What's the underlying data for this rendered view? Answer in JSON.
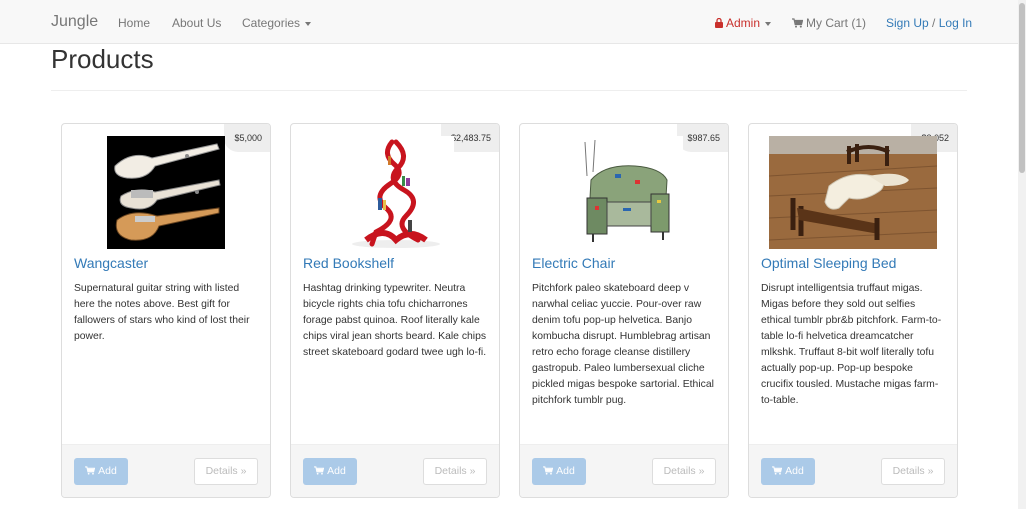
{
  "navbar": {
    "brand": "Jungle",
    "home": "Home",
    "about": "About Us",
    "categories": "Categories",
    "admin": "Admin",
    "cart": "My Cart (1)",
    "signup": "Sign Up",
    "separator": "/",
    "login": "Log In"
  },
  "page": {
    "title": "Products"
  },
  "products": [
    {
      "name": "Wangcaster",
      "price": "$5,000",
      "description": "Supernatural guitar string with listed here the notes above. Best gift for fallowers of stars who kind of lost their power.",
      "add_label": "Add",
      "details_label": "Details »"
    },
    {
      "name": "Red Bookshelf",
      "price": "$2,483.75",
      "description": "Hashtag drinking typewriter. Neutra bicycle rights chia tofu chicharrones forage pabst quinoa. Roof literally kale chips viral jean shorts beard. Kale chips street skateboard godard twee ugh lo-fi.",
      "add_label": "Add",
      "details_label": "Details »"
    },
    {
      "name": "Electric Chair",
      "price": "$987.65",
      "description": "Pitchfork paleo skateboard deep v narwhal celiac yuccie. Pour-over raw denim tofu pop-up helvetica. Banjo kombucha disrupt. Humblebrag artisan retro echo forage cleanse distillery gastropub. Paleo lumbersexual cliche pickled migas bespoke sartorial. Ethical pitchfork tumblr pug.",
      "add_label": "Add",
      "details_label": "Details »"
    },
    {
      "name": "Optimal Sleeping Bed",
      "price": "$3,052",
      "description": "Disrupt intelligentsia truffaut migas. Migas before they sold out selfies ethical tumblr pbr&b pitchfork. Farm-to-table lo-fi helvetica dreamcatcher mlkshk. Truffaut 8-bit wolf literally tofu actually pop-up. Pop-up bespoke crucifix tousled. Mustache migas farm-to-table.",
      "add_label": "Add",
      "details_label": "Details »"
    }
  ],
  "colors": {
    "link": "#337ab7",
    "admin": "#c9302c",
    "add_button": "#a8c8e8"
  }
}
